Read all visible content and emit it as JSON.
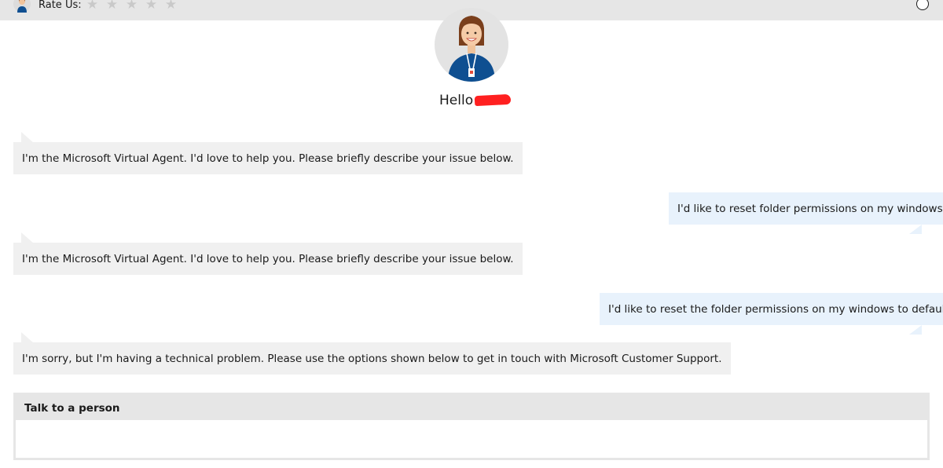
{
  "topbar": {
    "rate_label": "Rate Us:",
    "stars": [
      "★",
      "★",
      "★",
      "★",
      "★"
    ],
    "star_rating": 0
  },
  "header": {
    "greeting": "Hello"
  },
  "messages": [
    {
      "from": "bot",
      "text": "I'm the Microsoft Virtual Agent. I'd love to help you. Please briefly describe your issue below."
    },
    {
      "from": "user",
      "text": "I'd like to reset folder permissions on my windows"
    },
    {
      "from": "bot",
      "text": "I'm the Microsoft Virtual Agent. I'd love to help you. Please briefly describe your issue below."
    },
    {
      "from": "user",
      "text": "I'd like to reset the folder permissions on my windows to default"
    },
    {
      "from": "bot",
      "text": "I'm sorry, but I'm having a technical problem. Please use the options shown below to get in touch with Microsoft Customer Support."
    }
  ],
  "talk": {
    "title": "Talk to a person"
  },
  "colors": {
    "topbar_bg": "#e6e6e6",
    "bot_bubble": "#f0f0f0",
    "user_bubble": "#e8f2fc",
    "avatar_bg": "#e3e3e3",
    "shirt": "#0f4f91",
    "redaction": "#ff2020"
  }
}
